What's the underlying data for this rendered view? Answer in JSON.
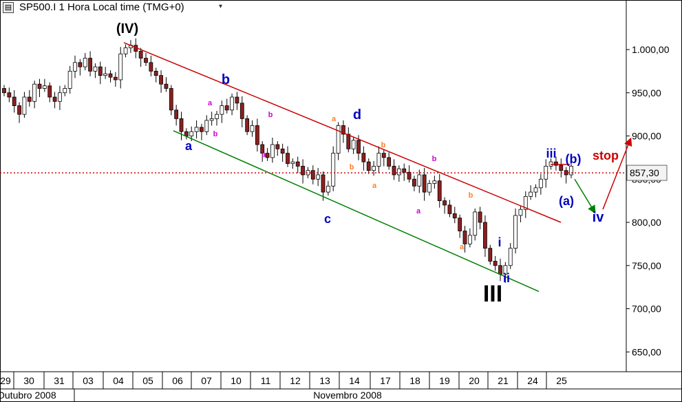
{
  "header": {
    "title": "SP500.I 1 Hora Local time (TMG+0)",
    "menu_icon": "chart-menu-icon",
    "dropdown_icon": "chevron-down-icon"
  },
  "price_label": "857,30",
  "x_axis": {
    "ticks": [
      "29",
      "30",
      "31",
      "03",
      "04",
      "05",
      "06",
      "07",
      "10",
      "11",
      "12",
      "13",
      "14",
      "17",
      "18",
      "19",
      "20",
      "21",
      "24",
      "25"
    ],
    "months": [
      "Outubro 2008",
      "Novembro 2008"
    ]
  },
  "chart_data": {
    "type": "candlestick",
    "title": "SP500.I 1 Hora Local time (TMG+0)",
    "y_ticks": [
      "1.000,00",
      "950,00",
      "900,00",
      "850,00",
      "800,00",
      "750,00",
      "700,00",
      "650,00"
    ],
    "y_tick_values": [
      1000,
      950,
      900,
      850,
      800,
      750,
      700,
      650
    ],
    "ylim": [
      610,
      1060
    ],
    "current_price": 857.3,
    "colors": {
      "up": "#ffffff",
      "down": "#8b2020",
      "upper_channel": "#cc0000",
      "lower_channel": "#008000",
      "price_line": "#cc0000"
    },
    "closes": [
      950,
      945,
      935,
      925,
      945,
      940,
      960,
      955,
      958,
      945,
      940,
      950,
      955,
      975,
      985,
      980,
      990,
      975,
      980,
      970,
      972,
      968,
      965,
      995,
      1002,
      1005,
      998,
      990,
      985,
      975,
      970,
      960,
      955,
      930,
      920,
      905,
      900,
      905,
      910,
      905,
      918,
      920,
      925,
      935,
      930,
      945,
      938,
      920,
      905,
      912,
      890,
      880,
      875,
      890,
      885,
      880,
      868,
      870,
      865,
      855,
      860,
      850,
      855,
      835,
      842,
      880,
      912,
      902,
      885,
      895,
      880,
      870,
      860,
      865,
      880,
      875,
      865,
      855,
      862,
      858,
      850,
      842,
      855,
      835,
      845,
      848,
      825,
      820,
      810,
      805,
      790,
      775,
      785,
      812,
      800,
      770,
      755,
      750,
      740,
      750,
      770,
      808,
      815,
      830,
      835,
      840,
      850,
      865,
      870,
      866,
      860,
      855,
      865
    ],
    "annotations": [
      {
        "text": "(IV)",
        "color": "#000000",
        "value": 1010,
        "index": 24
      },
      {
        "text": "b",
        "color": "#0000c0",
        "value": 950,
        "index": 45
      },
      {
        "text": "a",
        "color": "#0000c0",
        "value": 880,
        "index": 36
      },
      {
        "text": "a",
        "color": "#d000d0",
        "value": 935,
        "index": 42
      },
      {
        "text": "b",
        "color": "#d000d0",
        "value": 900,
        "index": 43
      },
      {
        "text": "b",
        "color": "#d000d0",
        "value": 915,
        "index": 56
      },
      {
        "text": "a",
        "color": "#d000d0",
        "value": 868,
        "index": 53
      },
      {
        "text": "c",
        "color": "#0000c0",
        "value": 795,
        "index": 66
      },
      {
        "text": "a",
        "color": "#ff7f27",
        "value": 920,
        "index": 67
      },
      {
        "text": "d",
        "color": "#0000c0",
        "value": 920,
        "index": 72
      },
      {
        "text": "b",
        "color": "#ff7f27",
        "value": 885,
        "index": 78
      },
      {
        "text": "b",
        "color": "#ff7f27",
        "value": 855,
        "index": 71
      },
      {
        "text": "a",
        "color": "#ff7f27",
        "value": 838,
        "index": 75
      },
      {
        "text": "b",
        "color": "#d000d0",
        "value": 865,
        "index": 88
      },
      {
        "text": "a",
        "color": "#d000d0",
        "value": 820,
        "index": 85
      },
      {
        "text": "b",
        "color": "#ff7f27",
        "value": 826,
        "index": 96
      },
      {
        "text": "a",
        "color": "#ff7f27",
        "value": 780,
        "index": 94
      },
      {
        "text": "i",
        "color": "#0000c0",
        "value": 775,
        "index": 102
      },
      {
        "text": "ii",
        "color": "#0000c0",
        "value": 732,
        "index": 103
      },
      {
        "text": "III",
        "color": "#000000",
        "value": 710,
        "index": 100
      },
      {
        "text": "iii",
        "color": "#0000c0",
        "value": 877,
        "index": 112
      },
      {
        "text": "(b)",
        "color": "#0000c0",
        "value": 865,
        "index": 117
      },
      {
        "text": "(a)",
        "color": "#0000c0",
        "value": 820,
        "index": 116
      },
      {
        "text": "iv",
        "color": "#0000c0",
        "value": 798,
        "index": 122
      },
      {
        "text": "stop",
        "color": "#cc0000",
        "value": 870,
        "index": 123
      }
    ]
  }
}
